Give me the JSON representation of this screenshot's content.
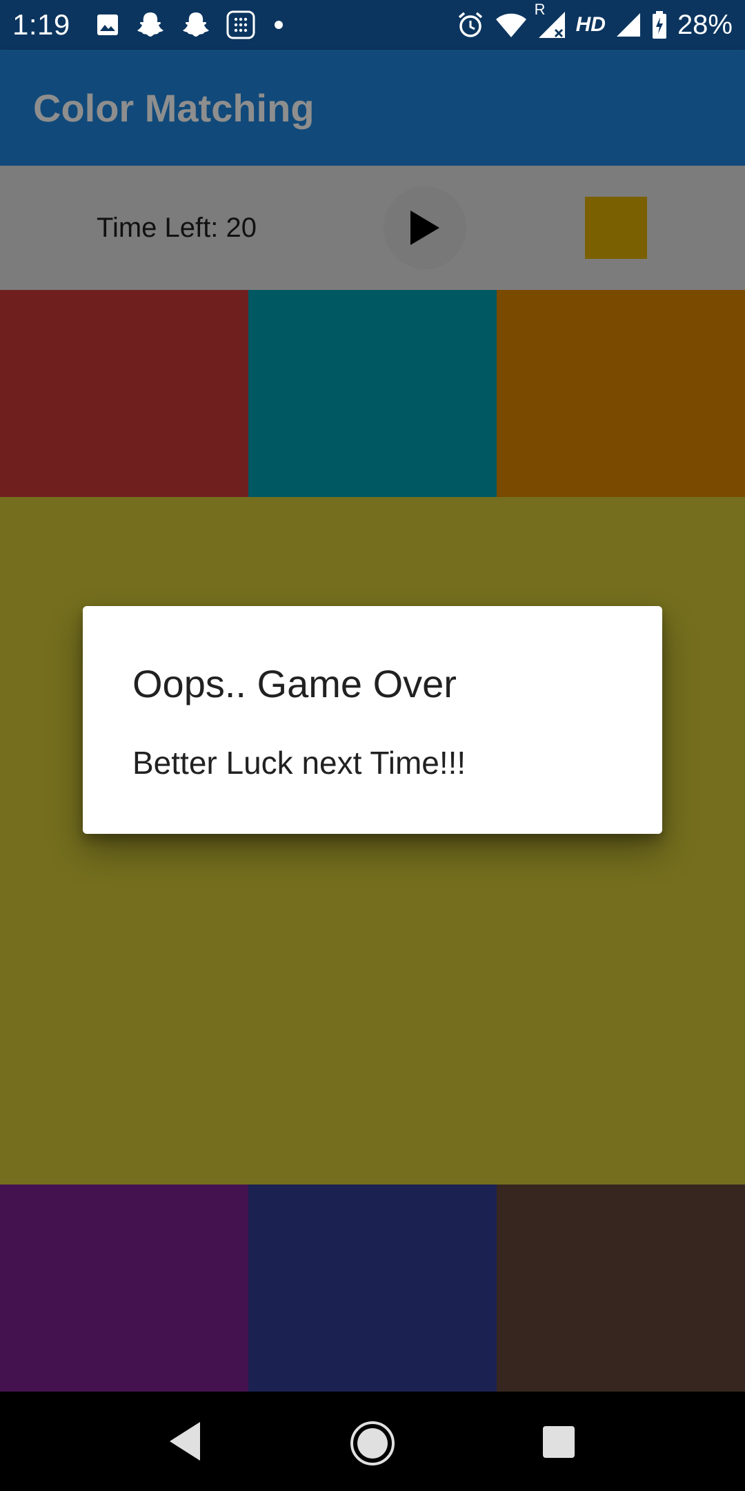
{
  "status_bar": {
    "time": "1:19",
    "battery": "28%",
    "network_label": "HD",
    "roaming_label": "R",
    "icons": [
      "image-icon",
      "snapchat-icon",
      "snapchat-icon",
      "keypad-icon",
      "dot-icon",
      "alarm-icon",
      "wifi-icon",
      "signal-icon",
      "signal-icon",
      "battery-icon"
    ]
  },
  "app_bar": {
    "title": "Color Matching"
  },
  "controls": {
    "time_left": "Time Left: 20",
    "play_icon": "play-icon",
    "target_color": "#7a6000"
  },
  "tiles": {
    "colors": [
      "#701f1f",
      "#005863",
      "#7a4a00",
      "#746e1e",
      "#451250",
      "#1b2151",
      "#372620"
    ]
  },
  "dialog": {
    "title": "Oops.. Game Over",
    "message": "Better Luck next Time!!!"
  },
  "nav_bar": {
    "icons": [
      "back-icon",
      "home-icon",
      "recents-icon"
    ]
  }
}
